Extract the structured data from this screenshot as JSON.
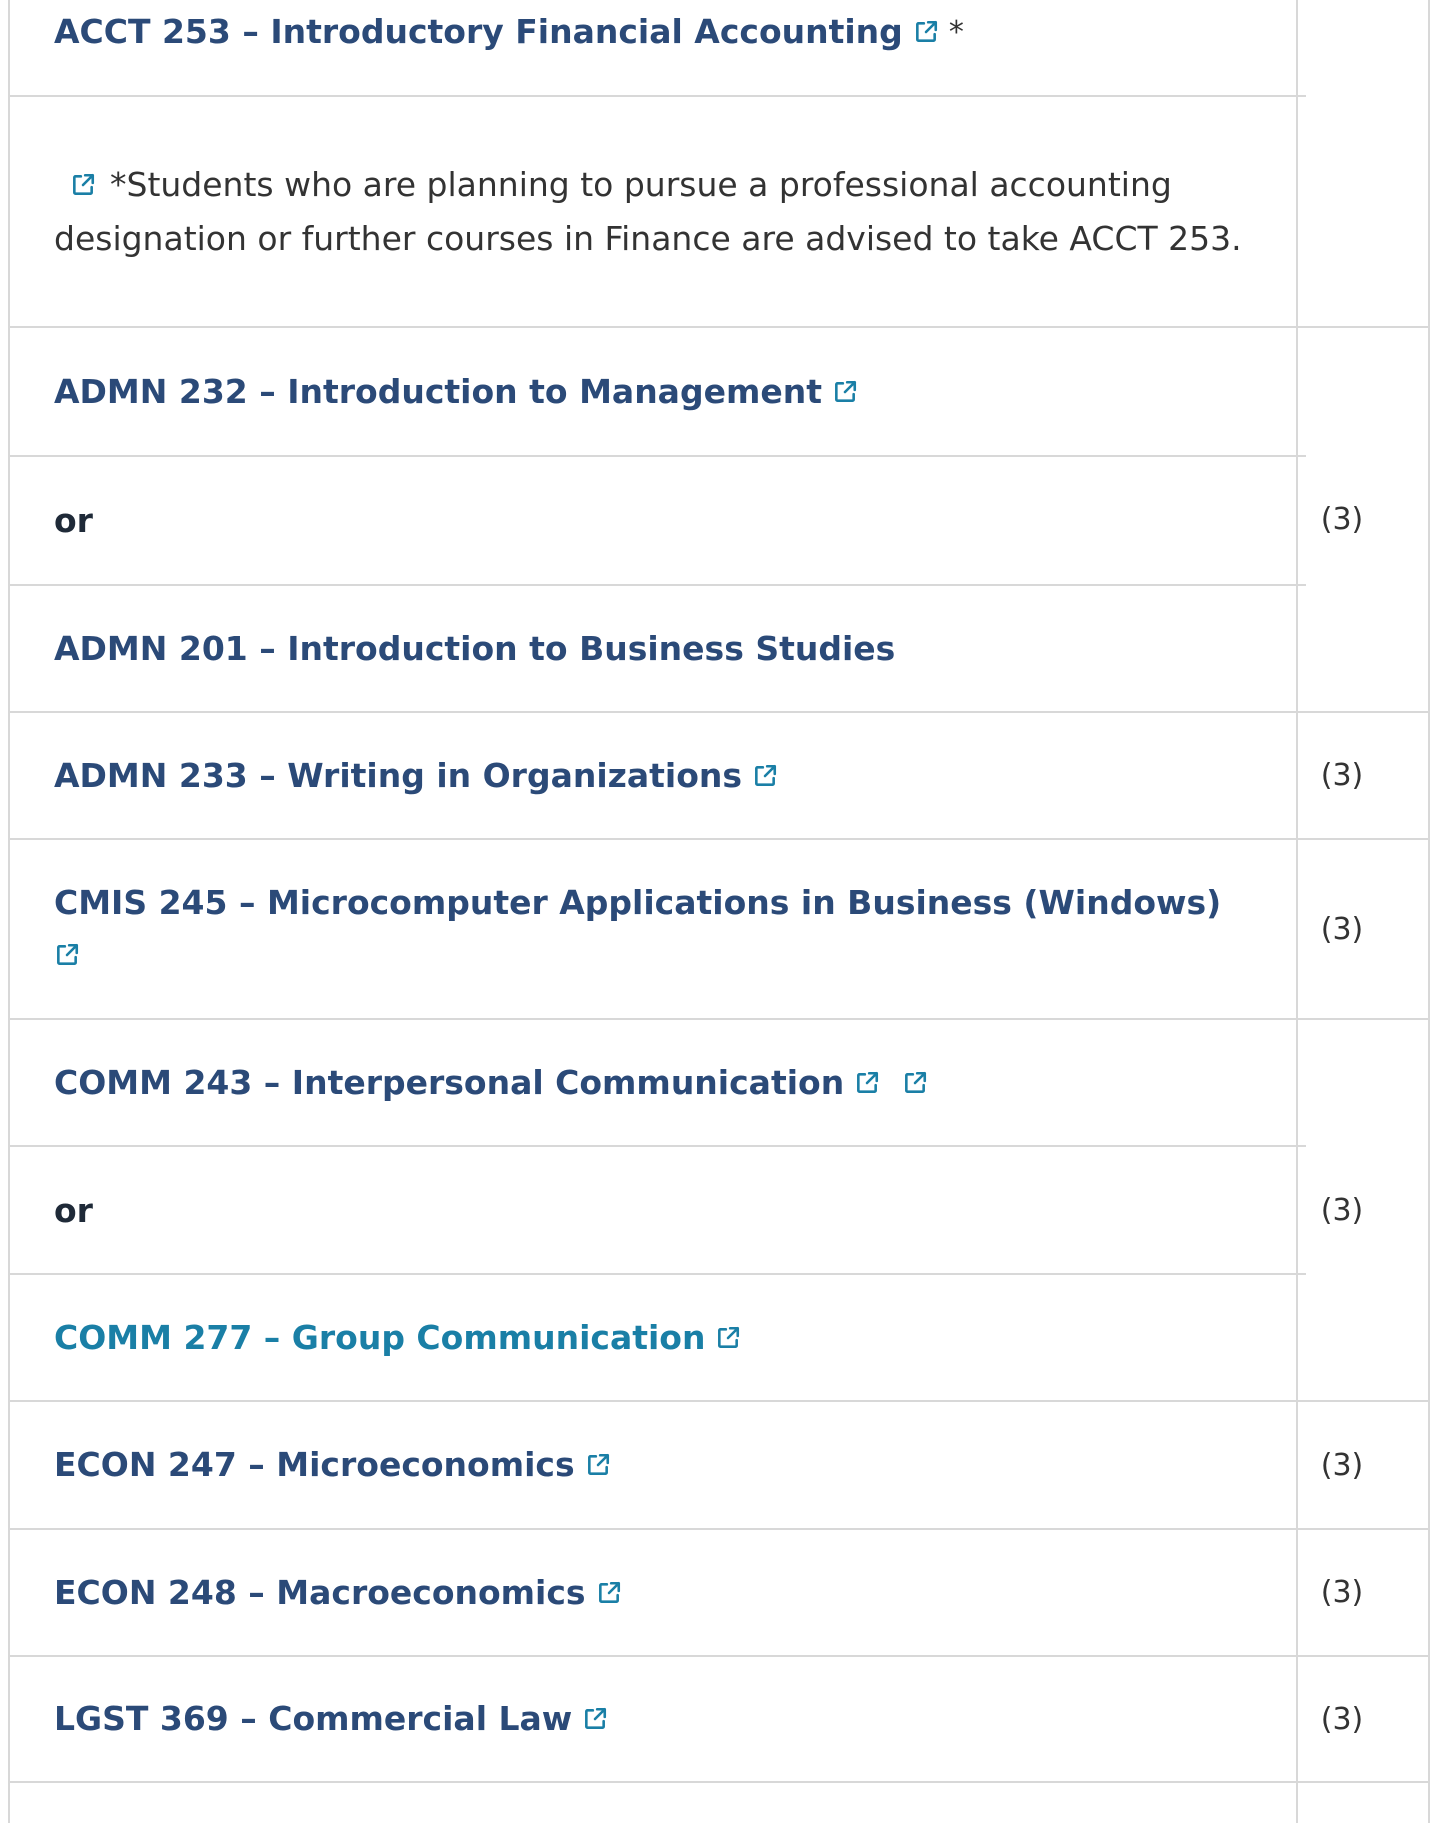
{
  "table": {
    "rows": [
      {
        "course": "ACCT 253 – Introductory Financial Accounting",
        "suffix": "*"
      },
      {
        "note": "*Students who are planning to pursue a professional accounting designation or further courses in Finance are advised to take ACCT 253."
      },
      {
        "course": "ADMN 232 – Introduction to Management"
      },
      {
        "or_label": "or",
        "credits": "(3)"
      },
      {
        "course": "ADMN 201 – Introduction to Business Studies"
      },
      {
        "course": "ADMN 233 – Writing in Organizations",
        "credits": "(3)"
      },
      {
        "course": "CMIS 245 – Microcomputer Applications in Business (Windows)",
        "credits": "(3)"
      },
      {
        "course": "COMM 243 – Interpersonal Communication"
      },
      {
        "or_label": "or",
        "credits": "(3)"
      },
      {
        "course": "COMM 277 – Group Communication"
      },
      {
        "course": "ECON 247 – Microeconomics",
        "credits": "(3)"
      },
      {
        "course": "ECON 248 – Macroeconomics",
        "credits": "(3)"
      },
      {
        "course": "LGST 369 – Commercial Law",
        "credits": "(3)"
      }
    ]
  },
  "icons": {
    "external_link": "external-link-icon"
  },
  "colors": {
    "course_link": "#2b4a78",
    "course_link_active": "#1a7fa6",
    "icon": "#1a7fa6",
    "border": "#d8d8d8"
  }
}
